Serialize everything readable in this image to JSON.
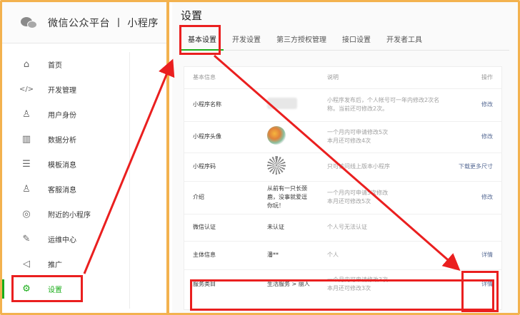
{
  "brand": {
    "title": "微信公众平台 丨 小程序"
  },
  "sidebar": {
    "items": [
      {
        "label": "首页",
        "icon": "home-icon",
        "glyph": "⌂"
      },
      {
        "label": "开发管理",
        "icon": "code-icon",
        "glyph": "</>"
      },
      {
        "label": "用户身份",
        "icon": "user-icon",
        "glyph": "♙"
      },
      {
        "label": "数据分析",
        "icon": "chart-icon",
        "glyph": "▥"
      },
      {
        "label": "模板消息",
        "icon": "document-icon",
        "glyph": "☰"
      },
      {
        "label": "客服消息",
        "icon": "service-icon",
        "glyph": "♙"
      },
      {
        "label": "附近的小程序",
        "icon": "location-icon",
        "glyph": "◎"
      },
      {
        "label": "运维中心",
        "icon": "wrench-icon",
        "glyph": "✎"
      },
      {
        "label": "推广",
        "icon": "megaphone-icon",
        "glyph": "◁"
      },
      {
        "label": "设置",
        "icon": "gear-icon",
        "glyph": "⚙",
        "active": true
      }
    ]
  },
  "main": {
    "title": "设置",
    "tabs": [
      "基本设置",
      "开发设置",
      "第三方授权管理",
      "接口设置",
      "开发者工具"
    ]
  },
  "table": {
    "headers": {
      "name": "基本信息",
      "desc": "说明",
      "op": "操作"
    },
    "rows": [
      {
        "name": "小程序名称",
        "value": "",
        "desc": "小程序发布后，个人帐号可一年内修改2次名称。当前还可修改2次。",
        "op": "修改"
      },
      {
        "name": "小程序头像",
        "value": "",
        "desc": "一个月内可申请修改5次\n本月还可修改4次",
        "op": "修改"
      },
      {
        "name": "小程序码",
        "value": "",
        "desc": "只可访问线上版本小程序",
        "op": "下载更多尺寸"
      },
      {
        "name": "介绍",
        "value": "从前有一只长颈鹿，没事就爱逗你玩！",
        "desc": "一个月内可申请5次修改\n本月还可修改5次",
        "op": "修改"
      },
      {
        "name": "微信认证",
        "value": "未认证",
        "desc": "个人号无法认证",
        "op": ""
      },
      {
        "name": "主体信息",
        "value": "潘**",
        "desc": "个人",
        "op": "详情"
      },
      {
        "name": "服务类目",
        "value": "生活服务 > 丽人",
        "desc": "一个月内可申请修改3次\n本月还可修改3次",
        "op": "详情"
      }
    ]
  },
  "colors": {
    "accent": "#1aad19",
    "link": "#576b95",
    "highlight": "#ea1f1f",
    "frame": "#f3b24f"
  }
}
